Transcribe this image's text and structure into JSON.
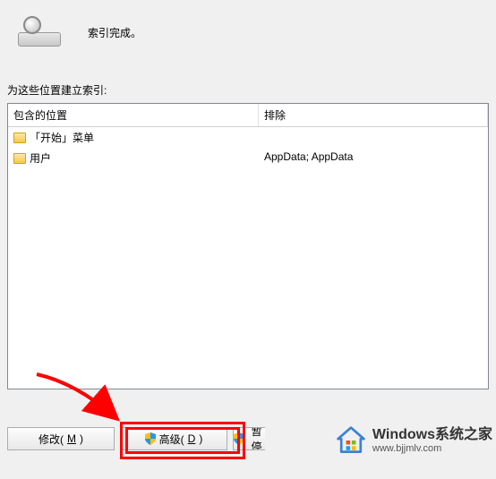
{
  "status": {
    "text": "索引完成。"
  },
  "section_label": "为这些位置建立索引:",
  "columns": {
    "included": "包含的位置",
    "excluded": "排除"
  },
  "rows": [
    {
      "name": "「开始」菜单",
      "excluded": ""
    },
    {
      "name": "用户",
      "excluded": "AppData; AppData"
    }
  ],
  "buttons": {
    "modify": {
      "label": "修改(",
      "hotkey": "M",
      "suffix": ")"
    },
    "advanced": {
      "label": "高级(",
      "hotkey": "D",
      "suffix": ")"
    },
    "pause": {
      "label": "暂停"
    }
  },
  "watermark": {
    "title": "Windows系统之家",
    "url": "www.bjjmlv.com"
  }
}
